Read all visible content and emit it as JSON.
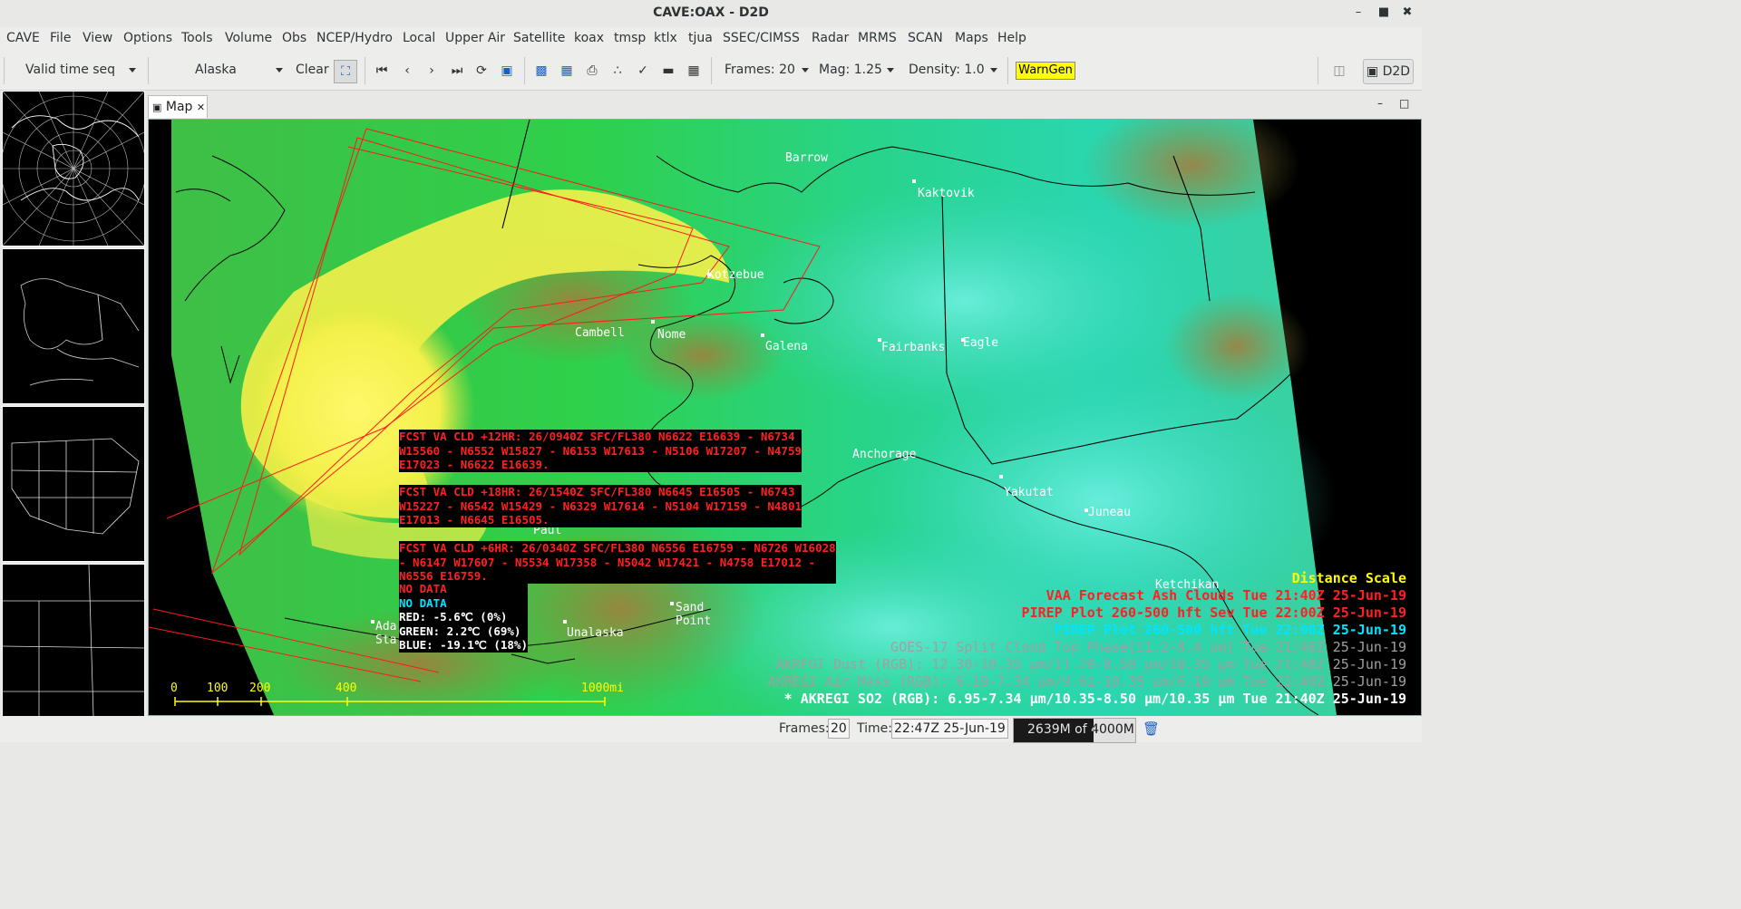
{
  "window": {
    "title": "CAVE:OAX - D2D"
  },
  "menu": [
    "CAVE",
    "File",
    "View",
    "Options",
    "Tools",
    "Volume",
    "Obs",
    "NCEP/Hydro",
    "Local",
    "Upper Air",
    "Satellite",
    "koax",
    "tmsp",
    "ktlx",
    "tjua",
    "SSEC/CIMSS",
    "Radar",
    "MRMS",
    "SCAN",
    "Maps",
    "Help"
  ],
  "toolbar": {
    "time_mode": "Valid time seq",
    "scale": "Alaska",
    "clear_label": "Clear",
    "frames_label": "Frames: 20",
    "mag_label": "Mag: 1.25",
    "density_label": "Density: 1.0",
    "warngen_label": "WarnGen",
    "perspective_label": "D2D"
  },
  "map_tab": {
    "label": "Map"
  },
  "places": [
    "Barrow",
    "Kaktovik",
    "Kotzebue",
    "Cambell",
    "Nome",
    "Galena",
    "Fairbanks",
    "Eagle",
    "Anchorage",
    "Yakutat",
    "Juneau",
    "Ketchikan",
    "Paul",
    "Sand",
    "Point",
    "Unalaska",
    "Ada",
    "Sta"
  ],
  "vaa_text": [
    [
      "FCST VA CLD +12HR: 26/0940Z SFC/FL380 N6622 E16639 - N6734",
      "W15560 - N6552 W15827 - N6153 W17613 - N5106 W17207 - N4759",
      "E17023 - N6622 E16639."
    ],
    [
      "FCST VA CLD +18HR: 26/1540Z SFC/FL380 N6645 E16505 - N6743",
      "W15227 - N6542 W15429 - N6329 W17614 - N5104 W17159 - N4801",
      "E17013 - N6645 E16505."
    ],
    [
      "FCST VA CLD +6HR: 26/0340Z SFC/FL380 N6556 E16759 - N6726 W16028",
      "- N6147 W17607 - N5534 W17358 - N5042 W17421 - N4758 E17012 -",
      "N6556 E16759."
    ]
  ],
  "sample": {
    "no_data_red": "NO DATA",
    "no_data_cyan": "NO DATA",
    "red": "RED: -5.6℃ (0%)",
    "green": "GREEN: 2.2℃ (69%)",
    "blue": "BLUE: -19.1℃ (18%)"
  },
  "scale_bar": {
    "ticks": [
      "0",
      "100",
      "200",
      "400",
      "1000mi"
    ]
  },
  "legend": [
    {
      "text": "Distance Scale",
      "color": "#ffff00"
    },
    {
      "text": "VAA Forecast Ash Clouds  Tue 21:40Z 25-Jun-19",
      "color": "#ff2020"
    },
    {
      "text": "PIREP Plot 260-500 hft Sev Tue 22:00Z 25-Jun-19",
      "color": "#ff2020"
    },
    {
      "text": "PIREP Plot 260-500 hft Tue 22:00Z 25-Jun-19",
      "color": "#00e5ff"
    },
    {
      "text": "GOES-17 Split Cloud Top Phase[11.2-8.4 um]  Tue 21:40Z 25-Jun-19",
      "color": "#a0a0a0"
    },
    {
      "text": "AKREGI Dust (RGB): 12.30-10.35 μm/11.20-8.50 μm/10.35 μm Tue 21:40Z 25-Jun-19",
      "color": "#a0a0a0"
    },
    {
      "text": "AKREGI Air Mass (RGB): 6.19-7.34 μm/9.61-10.35 μm/6.19 μm Tue 21:40Z 25-Jun-19",
      "color": "#a0a0a0"
    },
    {
      "text": "* AKREGI SO2 (RGB): 6.95-7.34 μm/10.35-8.50 μm/10.35 μm Tue 21:40Z 25-Jun-19",
      "color": "#ffffff"
    }
  ],
  "status": {
    "frames_label": "Frames:",
    "frames_value": "20",
    "time_label": "Time:",
    "time_value": "22:47Z 25-Jun-19",
    "memory": "2639M of 4000M"
  }
}
